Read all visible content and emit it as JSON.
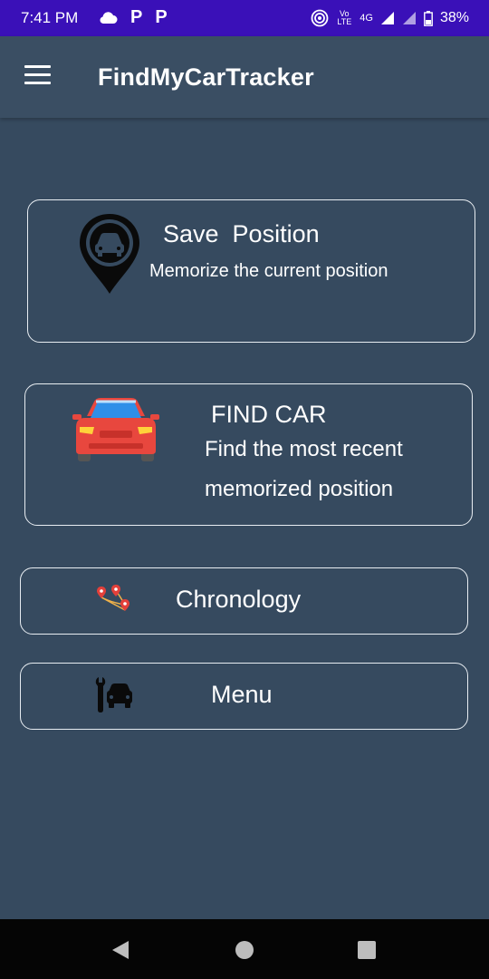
{
  "status_bar": {
    "time": "7:41 PM",
    "network": "4G",
    "volte": "Vo LTE",
    "battery": "38%",
    "icons": [
      "cloud-icon",
      "parking-p-icon",
      "parking-p-icon",
      "hotspot-icon",
      "signal-icon",
      "battery-icon"
    ]
  },
  "toolbar": {
    "title": "FindMyCarTracker",
    "menu_icon": "hamburger-icon"
  },
  "save_card": {
    "title": "Save  Position",
    "subtitle": "Memorize the current position",
    "icon": "car-location-pin-icon"
  },
  "find_card": {
    "title": "FIND CAR",
    "line1": "Find the most recent",
    "line2": "memorized position",
    "icon": "red-car-icon"
  },
  "chronology_card": {
    "label": "Chronology",
    "icon": "route-pins-icon"
  },
  "menu_card": {
    "label": "Menu",
    "icon": "car-wrench-icon"
  },
  "nav": {
    "icons": [
      "back-icon",
      "home-icon",
      "recents-icon"
    ]
  },
  "colors": {
    "background": "#364a5f",
    "status_bar": "#3a10b8",
    "toolbar": "#3a4e63",
    "car_red": "#e8473e",
    "windshield_blue": "#2f8fe8"
  }
}
